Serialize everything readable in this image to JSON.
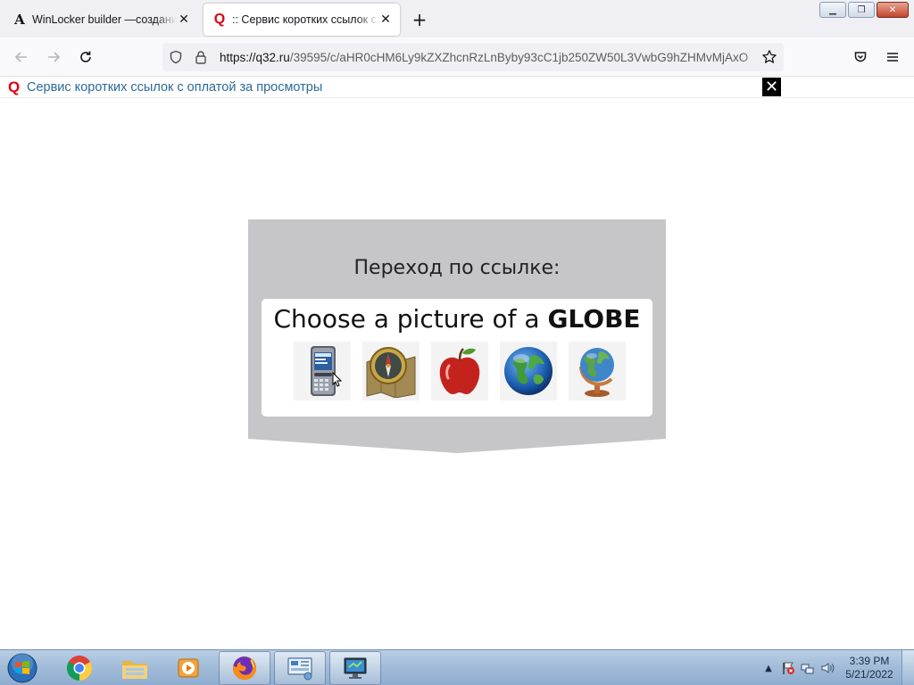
{
  "browser": {
    "tabs": [
      {
        "title": "WinLocker builder —создание",
        "favicon": "font-a-icon",
        "active": false
      },
      {
        "title": ":: Сервис коротких ссылок с оп",
        "favicon": "q32-logo-icon",
        "active": true
      }
    ],
    "address": {
      "url_host": "https://q32.ru",
      "url_path": "/39595/c/aHR0cHM6Ly9kZXZhcnRzLnByby93cC1jb250ZW50L3VwbG9hZHMvMjAxO"
    },
    "window_controls": {
      "minimize": "▁",
      "maximize": "❐",
      "close": "✕"
    }
  },
  "notice_bar": {
    "logo": "Q",
    "text": "Сервис коротких ссылок с оплатой за просмотры",
    "close_label": "✕"
  },
  "page": {
    "heading": "Переход по ссылке:",
    "captcha": {
      "prompt_prefix": "Choose a picture of a ",
      "prompt_target": "GLOBE",
      "choices": [
        {
          "name": "pda-phone"
        },
        {
          "name": "compass-map"
        },
        {
          "name": "apple"
        },
        {
          "name": "earth-globe"
        },
        {
          "name": "desk-globe"
        }
      ]
    }
  },
  "taskbar": {
    "clock": {
      "time": "3:39 PM",
      "date": "5/21/2022"
    },
    "tray_arrow": "▲",
    "pinned": [
      {
        "name": "chrome",
        "open": false
      },
      {
        "name": "file-explorer",
        "open": false
      },
      {
        "name": "media-player",
        "open": false
      },
      {
        "name": "firefox",
        "open": true
      },
      {
        "name": "control-panel",
        "open": true
      },
      {
        "name": "remote-desktop",
        "open": true
      }
    ]
  }
}
